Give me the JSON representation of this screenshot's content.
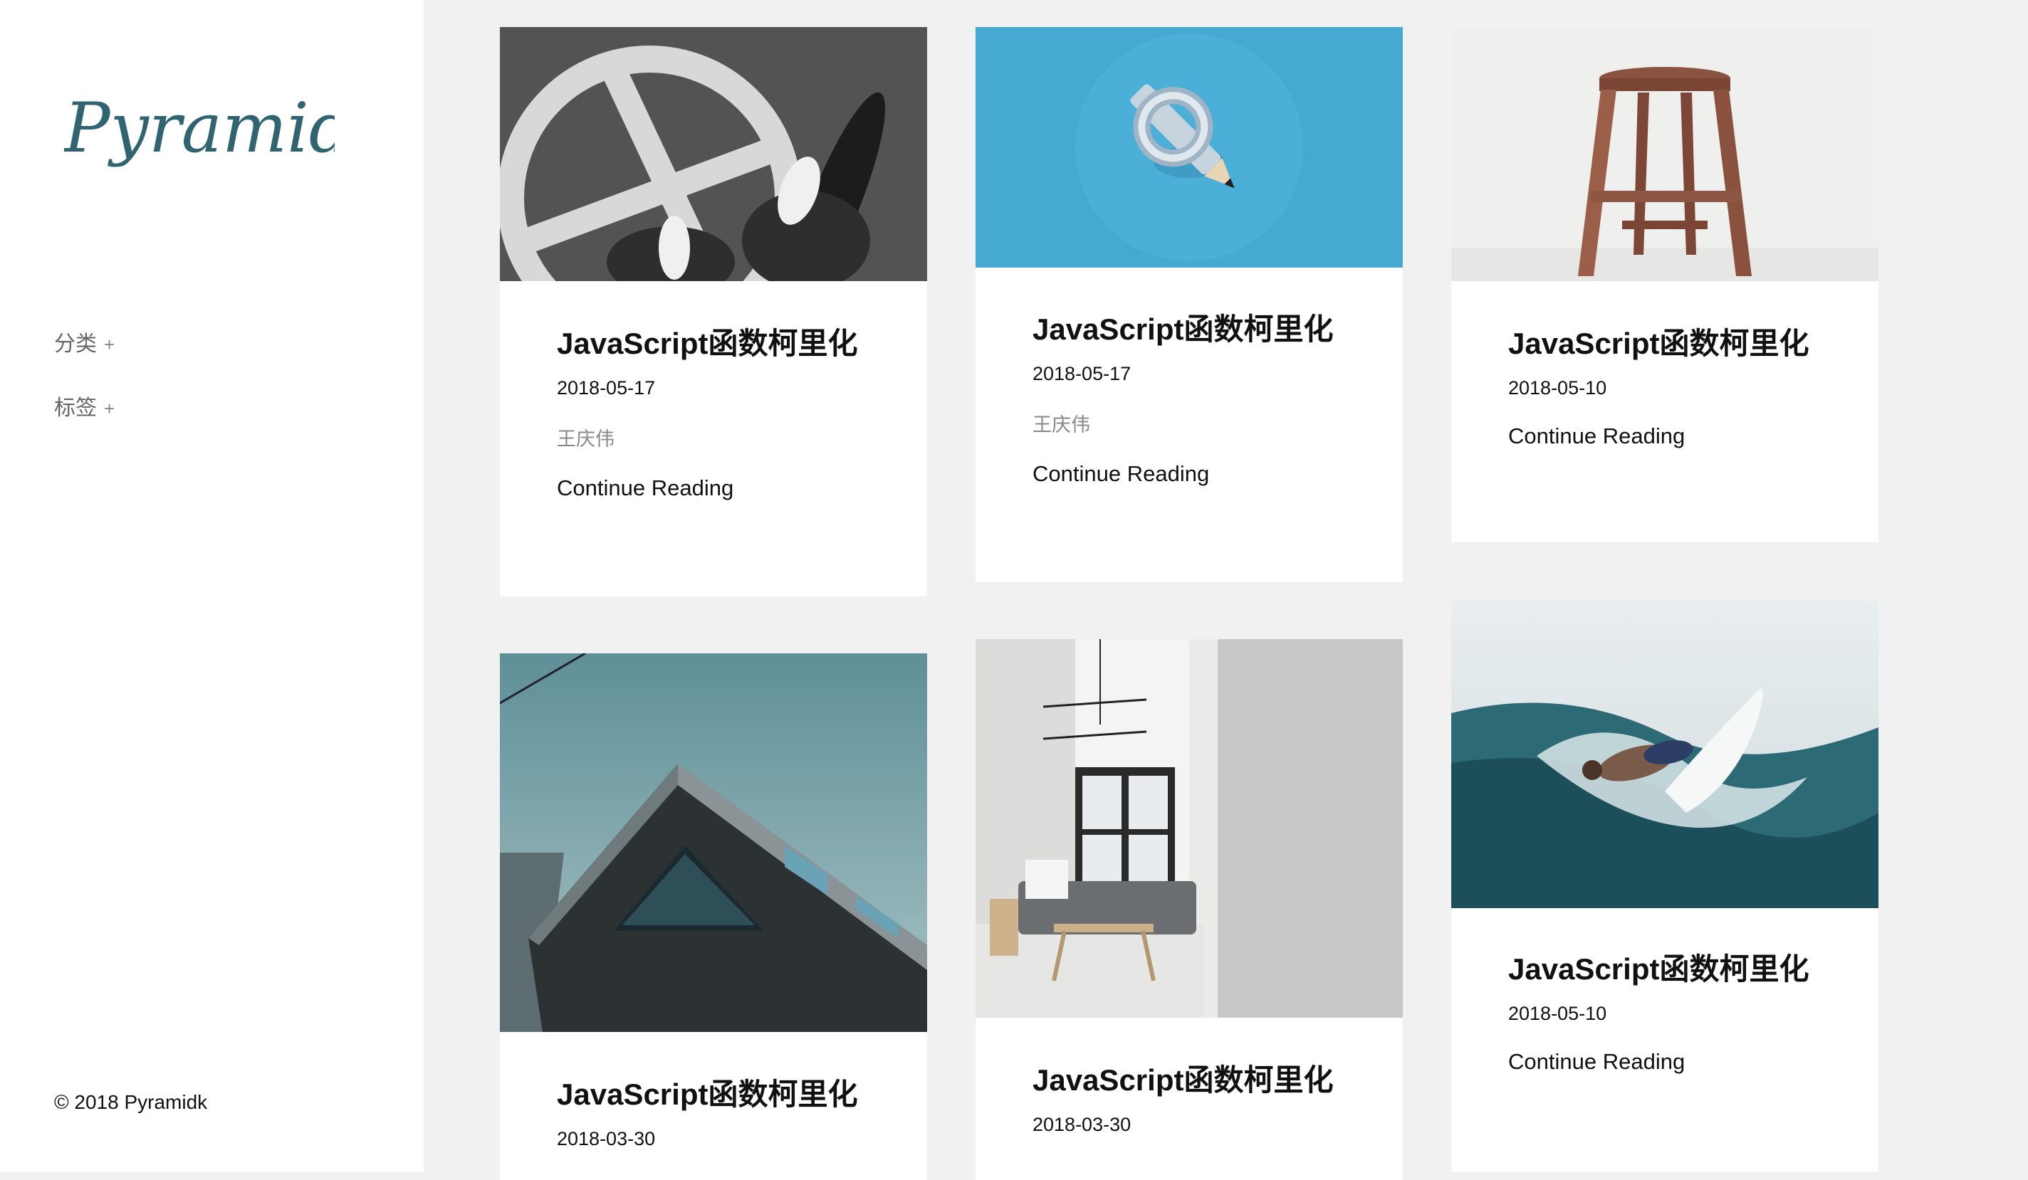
{
  "site": {
    "logo_text": "Pyramid",
    "nav": [
      {
        "label": "分类",
        "expand": "+"
      },
      {
        "label": "标签",
        "expand": "+"
      }
    ],
    "copyright": "© 2018 Pyramidk"
  },
  "posts": [
    {
      "title": "JavaScript函数柯里化",
      "date": "2018-05-17",
      "author": "王庆伟",
      "link": "Continue Reading",
      "image": "skateboard-photo"
    },
    {
      "title": "JavaScript函数柯里化",
      "date": "2018-05-17",
      "author": "王庆伟",
      "link": "Continue Reading",
      "image": "knotted-pencil-photo"
    },
    {
      "title": "JavaScript函数柯里化",
      "date": "2018-05-10",
      "link": "Continue Reading",
      "image": "wooden-stool-photo"
    },
    {
      "title": "JavaScript函数柯里化",
      "date": "2018-03-30",
      "image": "dark-house-photo"
    },
    {
      "title": "JavaScript函数柯里化",
      "date": "2018-03-30",
      "image": "living-room-photo"
    },
    {
      "title": "JavaScript函数柯里化",
      "date": "2018-05-10",
      "link": "Continue Reading",
      "image": "surfer-photo"
    }
  ],
  "colors": {
    "logo": "#2f6470",
    "background": "#f1f1f1",
    "card": "#ffffff"
  }
}
